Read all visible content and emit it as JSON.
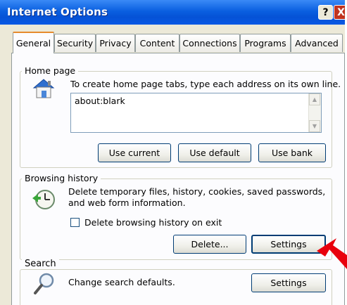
{
  "window": {
    "title": "Internet Options",
    "help_label": "?",
    "close_label": "X"
  },
  "tabs": [
    {
      "label": "General"
    },
    {
      "label": "Security"
    },
    {
      "label": "Privacy"
    },
    {
      "label": "Content"
    },
    {
      "label": "Connections"
    },
    {
      "label": "Programs"
    },
    {
      "label": "Advanced"
    }
  ],
  "home_page": {
    "group_label": "Home page",
    "description": "To create home page tabs, type each address on its own line.",
    "value": "about:blark",
    "use_current_label": "Use current",
    "use_default_label": "Use default",
    "use_blank_label": "Use bank"
  },
  "browsing_history": {
    "group_label": "Browsing history",
    "description_line1": "Delete temporary files, history, cookies, saved passwords,",
    "description_line2": "and web form information.",
    "checkbox_label": "Delete browsing history on exit",
    "checkbox_checked": false,
    "delete_label": "Delete...",
    "settings_label": "Settings"
  },
  "search": {
    "group_label": "Search",
    "description": "Change search defaults.",
    "settings_label": "Settings"
  },
  "icons": {
    "home": "house-icon",
    "history": "history-clock-icon",
    "search": "magnifier-icon",
    "pointer": "red-arrow-pointer"
  },
  "colors": {
    "titlebar": "#0a5fe0",
    "active_tab_accent": "#e68b2c",
    "arrow": "#e8000c"
  }
}
